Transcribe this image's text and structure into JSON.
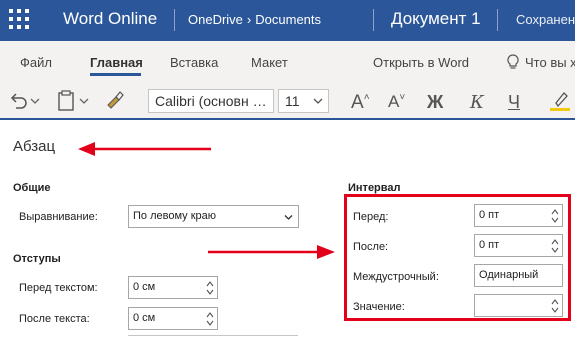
{
  "titlebar": {
    "app_name": "Word Online",
    "breadcrumb_root": "OneDrive",
    "breadcrumb_chevron": "›",
    "breadcrumb_folder": "Documents",
    "doc_title": "Документ 1",
    "save_status": "Сохранен"
  },
  "tabs": {
    "file": "Файл",
    "home": "Главная",
    "insert": "Вставка",
    "layout": "Макет",
    "open_in_word": "Открыть в Word",
    "tell_me": "Что вы х"
  },
  "toolbar": {
    "font_name": "Calibri (основн …",
    "font_size": "11",
    "grow_font": "A",
    "shrink_font": "A",
    "bold": "Ж",
    "italic": "К",
    "underline": "Ч"
  },
  "pane": {
    "title": "Абзац",
    "general": {
      "heading": "Общие",
      "alignment_label": "Выравнивание:",
      "alignment_value": "По левому краю"
    },
    "indents": {
      "heading": "Отступы",
      "before_label": "Перед текстом:",
      "before_value": "0 см",
      "after_label": "После текста:",
      "after_value": "0 см"
    },
    "spacing": {
      "heading": "Интервал",
      "before_label": "Перед:",
      "before_value": "0 пт",
      "after_label": "После:",
      "after_value": "0 пт",
      "line_label": "Междустрочный:",
      "line_value": "Одинарный",
      "value_label": "Значение:",
      "value_value": ""
    }
  },
  "colors": {
    "brand": "#2b579a",
    "annotation": "#e3001b",
    "highlighter": "#f2c811"
  },
  "icons": [
    "app-launcher-icon",
    "chevron-right-icon",
    "lightbulb-icon",
    "undo-icon",
    "paste-icon",
    "format-painter-icon",
    "chevron-down-icon",
    "spin-icon",
    "highlighter-icon",
    "arrow-icon"
  ]
}
